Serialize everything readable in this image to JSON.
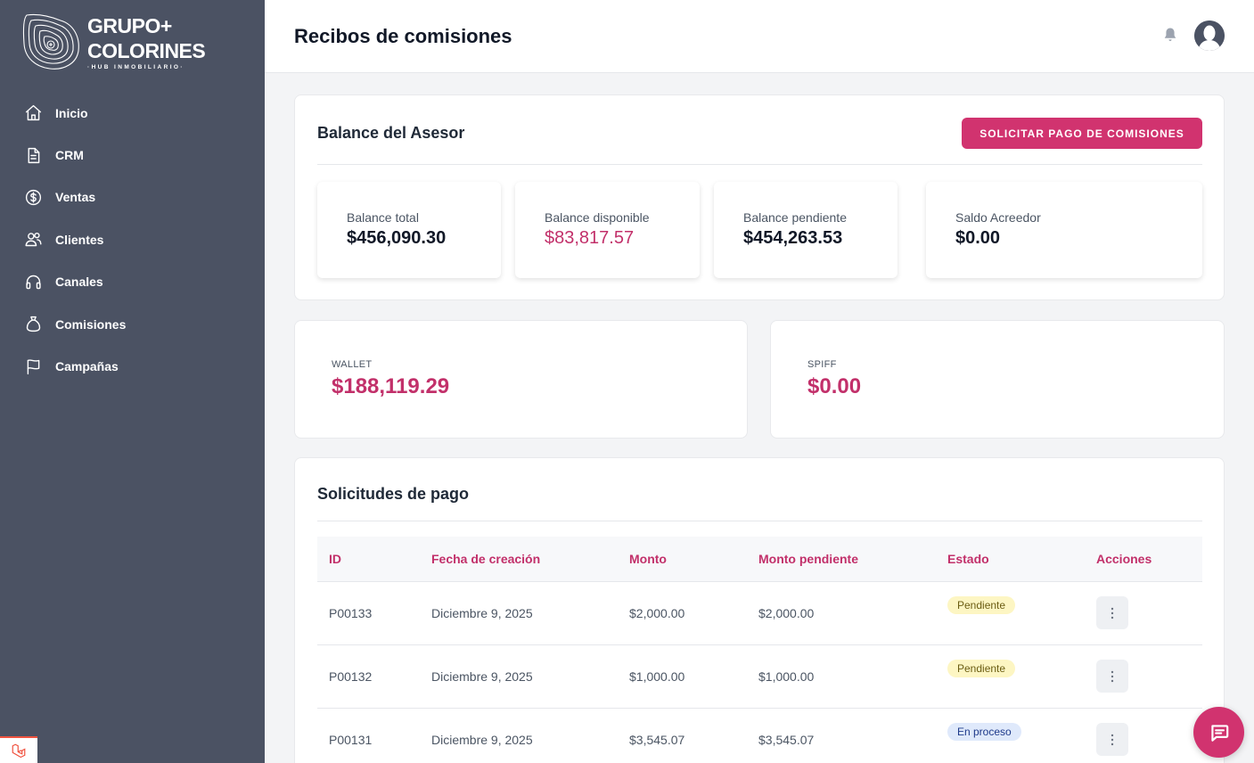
{
  "brand": {
    "line1": "GRUPO+",
    "line2": "COLORINES",
    "sub": "·HUB INMOBILIARIO·"
  },
  "sidebar": {
    "items": [
      {
        "label": "Inicio",
        "icon": "home-icon"
      },
      {
        "label": "CRM",
        "icon": "document-icon"
      },
      {
        "label": "Ventas",
        "icon": "dollar-circle-icon"
      },
      {
        "label": "Clientes",
        "icon": "users-icon"
      },
      {
        "label": "Canales",
        "icon": "headset-icon"
      },
      {
        "label": "Comisiones",
        "icon": "money-bag-icon"
      },
      {
        "label": "Campañas",
        "icon": "flag-icon"
      }
    ]
  },
  "header": {
    "title": "Recibos de comisiones"
  },
  "balance": {
    "title": "Balance del Asesor",
    "request_button": "SOLICITAR PAGO DE COMISIONES",
    "stats": [
      {
        "label": "Balance total",
        "value": "$456,090.30"
      },
      {
        "label": "Balance disponible",
        "value": "$83,817.57"
      },
      {
        "label": "Balance pendiente",
        "value": "$454,263.53"
      },
      {
        "label": "Saldo Acreedor",
        "value": "$0.00"
      }
    ]
  },
  "wallet": {
    "label": "WALLET",
    "value": "$188,119.29"
  },
  "spiff": {
    "label": "SPIFF",
    "value": "$0.00"
  },
  "requests": {
    "title": "Solicitudes de pago",
    "columns": [
      "ID",
      "Fecha de creación",
      "Monto",
      "Monto pendiente",
      "Estado",
      "Acciones"
    ],
    "rows": [
      {
        "id": "P00133",
        "date": "Diciembre 9, 2025",
        "amount": "$2,000.00",
        "pending": "$2,000.00",
        "status": "Pendiente"
      },
      {
        "id": "P00132",
        "date": "Diciembre 9, 2025",
        "amount": "$1,000.00",
        "pending": "$1,000.00",
        "status": "Pendiente"
      },
      {
        "id": "P00131",
        "date": "Diciembre 9, 2025",
        "amount": "$3,545.07",
        "pending": "$3,545.07",
        "status": "En proceso"
      }
    ]
  },
  "colors": {
    "sidebar_bg": "#4b5263",
    "accent": "#d1336f",
    "pending_badge": "#fdf6c3",
    "in_process_badge": "#dfe9fb"
  }
}
